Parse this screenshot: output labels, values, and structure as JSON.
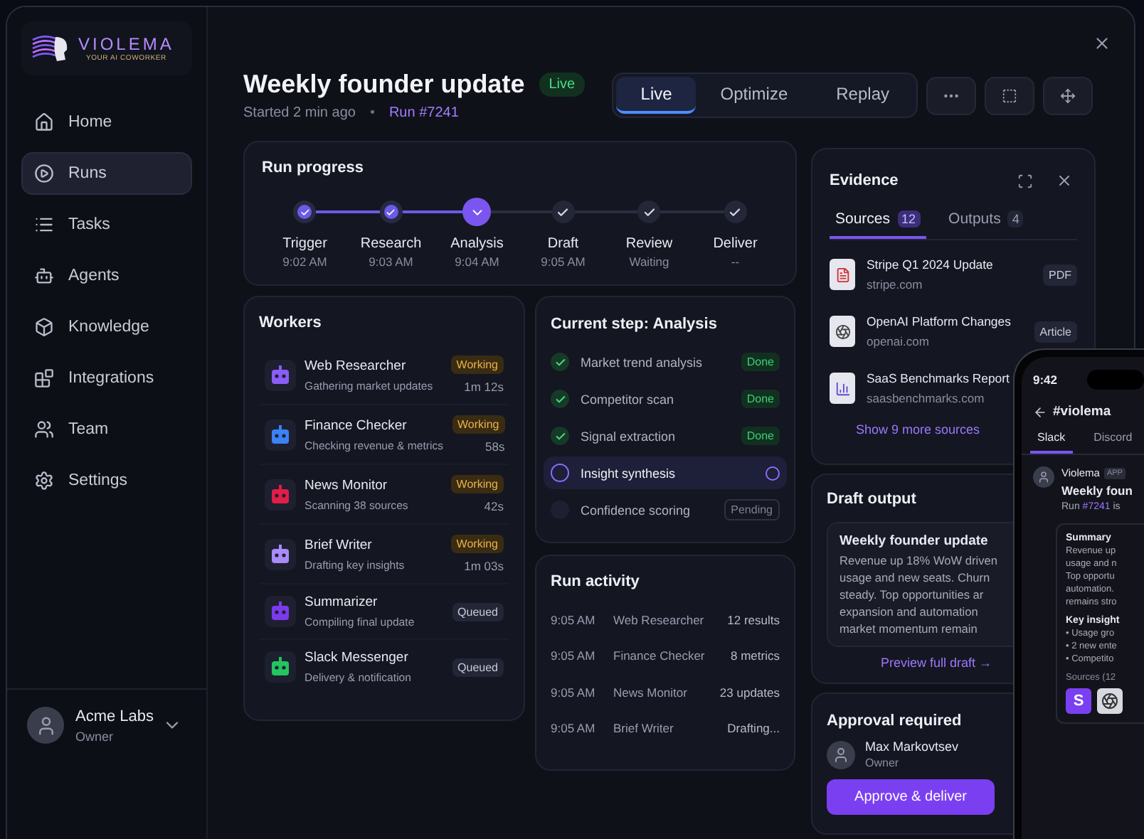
{
  "sidebar": {
    "logo": {
      "name": "VIOLEMA",
      "tagline": "YOUR AI COWORKER"
    },
    "items": [
      {
        "label": "Home",
        "selected": false
      },
      {
        "label": "Runs",
        "selected": true
      },
      {
        "label": "Tasks",
        "selected": false
      },
      {
        "label": "Agents",
        "selected": false
      },
      {
        "label": "Knowledge",
        "selected": false
      },
      {
        "label": "Integrations",
        "selected": false
      },
      {
        "label": "Team",
        "selected": false
      },
      {
        "label": "Settings",
        "selected": false
      }
    ],
    "account": {
      "name": "Acme Labs",
      "role": "Owner"
    }
  },
  "header": {
    "title": "Weekly founder update",
    "badge": "Live",
    "started": "Started 2 min ago",
    "separator": "•",
    "run": "Run #7241"
  },
  "mode_tabs": [
    {
      "label": "Live",
      "selected": true
    },
    {
      "label": "Optimize",
      "selected": false
    },
    {
      "label": "Replay",
      "selected": false
    }
  ],
  "run_progress": {
    "title": "Run progress",
    "steps": [
      {
        "label": "Trigger",
        "time": "9:02 AM",
        "done": true,
        "current": false
      },
      {
        "label": "Research",
        "time": "9:03 AM",
        "done": true,
        "current": false
      },
      {
        "label": "Analysis",
        "time": "9:04 AM",
        "done": false,
        "current": true
      },
      {
        "label": "Draft",
        "time": "9:05 AM",
        "done": false,
        "current": false
      },
      {
        "label": "Review",
        "time": "Waiting",
        "done": false,
        "current": false
      },
      {
        "label": "Deliver",
        "time": "--",
        "done": false,
        "current": false
      }
    ]
  },
  "workers": {
    "title": "Workers",
    "items": [
      {
        "name": "Web Researcher",
        "task": "Gathering market updates",
        "status": "Working",
        "active": true,
        "elapsed": "1m 12s",
        "color": "#8b5cf6"
      },
      {
        "name": "Finance Checker",
        "task": "Checking revenue & metrics",
        "status": "Working",
        "active": true,
        "elapsed": "58s",
        "color": "#3b82f6"
      },
      {
        "name": "News Monitor",
        "task": "Scanning 38 sources",
        "status": "Working",
        "active": true,
        "elapsed": "42s",
        "color": "#e11d48"
      },
      {
        "name": "Brief Writer",
        "task": "Drafting key insights",
        "status": "Working",
        "active": true,
        "elapsed": "1m 03s",
        "color": "#a78bfa"
      },
      {
        "name": "Summarizer",
        "task": "Compiling final update",
        "status": "Queued",
        "active": false,
        "color": "#7c3aed"
      },
      {
        "name": "Slack Messenger",
        "task": "Delivery & notification",
        "status": "Queued",
        "active": false,
        "color": "#22c55e"
      }
    ]
  },
  "current_step": {
    "title": "Current step: Analysis",
    "items": [
      {
        "label": "Market trend analysis",
        "done": true,
        "active": false,
        "badge": "Done"
      },
      {
        "label": "Competitor scan",
        "done": true,
        "active": false,
        "badge": "Done"
      },
      {
        "label": "Signal extraction",
        "done": true,
        "active": false,
        "badge": "Done"
      },
      {
        "label": "Insight synthesis",
        "done": false,
        "active": true
      },
      {
        "label": "Confidence scoring",
        "done": false,
        "active": false,
        "badge": "Pending"
      }
    ]
  },
  "run_activity": {
    "title": "Run activity",
    "rows": [
      {
        "time": "9:05 AM",
        "worker": "Web Researcher",
        "result": "12 results"
      },
      {
        "time": "9:05 AM",
        "worker": "Finance Checker",
        "result": "8 metrics"
      },
      {
        "time": "9:05 AM",
        "worker": "News Monitor",
        "result": "23 updates"
      },
      {
        "time": "9:05 AM",
        "worker": "Brief Writer",
        "result": "Drafting..."
      }
    ]
  },
  "evidence": {
    "title": "Evidence",
    "tabs": [
      {
        "label": "Sources",
        "count": "12",
        "selected": true
      },
      {
        "label": "Outputs",
        "count": "4",
        "selected": false
      }
    ],
    "sources": [
      {
        "title": "Stripe Q1 2024 Update",
        "domain": "stripe.com",
        "tag": "PDF",
        "kind": "pdf"
      },
      {
        "title": "OpenAI Platform Changes",
        "domain": "openai.com",
        "tag": "Article",
        "kind": "article"
      },
      {
        "title": "SaaS Benchmarks Report",
        "domain": "saasbenchmarks.com",
        "kind": "report"
      }
    ],
    "more": "Show 9 more sources"
  },
  "draft_output": {
    "title": "Draft output",
    "heading": "Weekly founder update",
    "lines": [
      "Revenue up 18% WoW driven",
      "usage and new seats. Churn",
      "steady. Top opportunities ar",
      "expansion and automation",
      "market momentum remain"
    ],
    "link": "Preview full draft →"
  },
  "approval": {
    "title": "Approval required",
    "approver": {
      "name": "Max Markovtsev",
      "role": "Owner"
    },
    "button": "Approve & deliver"
  },
  "phone": {
    "time": "9:42",
    "channel": "#violema",
    "tabs": [
      {
        "label": "Slack",
        "selected": true
      },
      {
        "label": "Discord",
        "selected": false
      }
    ],
    "message": {
      "sender": "Violema",
      "badge": "APP",
      "title": "Weekly foun",
      "intro": {
        "before": "Run",
        "link": "#7241",
        "after": "is"
      },
      "summary_title": "Summary",
      "summary_lines": [
        "Revenue up",
        "usage and n",
        "Top opportu",
        "automation.",
        "remains stro"
      ],
      "insights_title": "Key insight",
      "insights": [
        "• Usage gro",
        "• 2 new ente",
        "• Competito"
      ],
      "sources_label": "Sources (12",
      "source_badges": [
        {
          "kind": "letter",
          "text": "S"
        },
        {
          "kind": "logo"
        }
      ]
    }
  }
}
